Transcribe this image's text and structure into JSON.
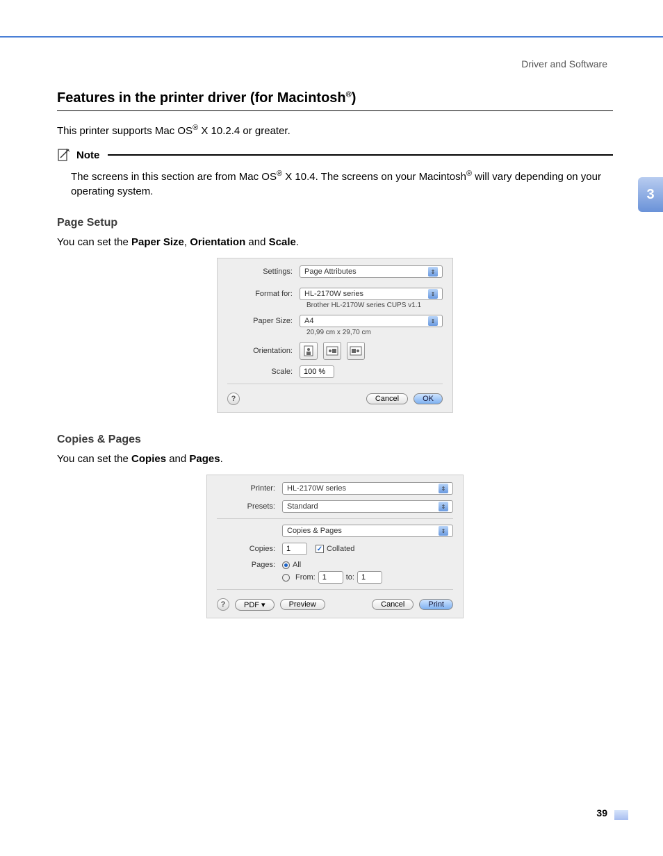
{
  "header": {
    "title": "Driver and Software"
  },
  "chapter": {
    "number": "3"
  },
  "heading": {
    "prefix": "Features in the printer driver (for Macintosh",
    "suffix": ")"
  },
  "intro": {
    "prefix": "This printer supports Mac OS",
    "suffix": " X 10.2.4 or greater."
  },
  "note": {
    "label": "Note",
    "body_a": "The screens in this section are from Mac OS",
    "body_b": " X 10.4. The screens on your Macintosh",
    "body_c": " will vary depending on your operating system."
  },
  "section1": {
    "heading": "Page Setup",
    "desc_prefix": "You can set the ",
    "term1": "Paper Size",
    "sep1": ", ",
    "term2": "Orientation",
    "sep2": " and ",
    "term3": "Scale",
    "desc_suffix": ".",
    "labels": {
      "settings": "Settings:",
      "format_for": "Format for:",
      "paper_size": "Paper Size:",
      "orientation": "Orientation:",
      "scale": "Scale:"
    },
    "values": {
      "settings": "Page Attributes",
      "format_for": "HL-2170W series",
      "format_sub": "Brother HL-2170W series CUPS v1.1",
      "paper_size": "A4",
      "paper_sub": "20,99 cm x 29,70 cm",
      "scale": "100 %"
    },
    "buttons": {
      "cancel": "Cancel",
      "ok": "OK",
      "help": "?"
    }
  },
  "section2": {
    "heading": "Copies & Pages",
    "desc_prefix": "You can set the ",
    "term1": "Copies",
    "sep1": " and ",
    "term2": "Pages",
    "desc_suffix": ".",
    "labels": {
      "printer": "Printer:",
      "presets": "Presets:",
      "section": "Copies & Pages",
      "copies": "Copies:",
      "collated": "Collated",
      "pages": "Pages:",
      "all": "All",
      "from": "From:",
      "to": "to:"
    },
    "values": {
      "printer": "HL-2170W series",
      "presets": "Standard",
      "copies": "1",
      "from": "1",
      "to": "1"
    },
    "buttons": {
      "help": "?",
      "pdf": "PDF ▾",
      "preview": "Preview",
      "cancel": "Cancel",
      "print": "Print"
    }
  },
  "page_number": "39",
  "reg": "®"
}
